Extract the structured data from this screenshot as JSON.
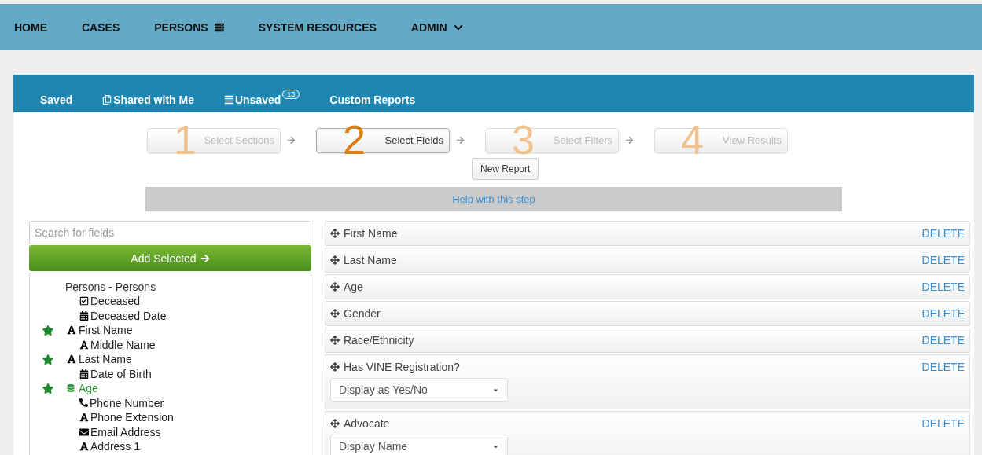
{
  "nav": [
    {
      "label": "HOME",
      "kind": "plain"
    },
    {
      "label": "CASES",
      "kind": "plain"
    },
    {
      "label": "PERSONS",
      "kind": "list"
    },
    {
      "label": "SYSTEM RESOURCES",
      "kind": "plain"
    },
    {
      "label": "ADMIN",
      "kind": "dropdown"
    }
  ],
  "report_tabs": [
    {
      "label": "Saved",
      "kind": "plain"
    },
    {
      "label": "Shared with Me",
      "kind": "shared"
    },
    {
      "label": "Unsaved",
      "kind": "unsaved",
      "badge": "13"
    },
    {
      "label": "Custom Reports",
      "kind": "plain"
    }
  ],
  "steps": [
    {
      "number": "1",
      "label": "Select Sections",
      "selected": false
    },
    {
      "number": "2",
      "label": "Select Fields",
      "selected": true
    },
    {
      "number": "3",
      "label": "Select Filters",
      "selected": false
    },
    {
      "number": "4",
      "label": "View Results",
      "selected": false
    }
  ],
  "new_report_button": "New Report",
  "help_link": "Help with this step",
  "search": {
    "placeholder": "Search for fields"
  },
  "add_button": "Add Selected",
  "tree": {
    "label": "Persons - Persons",
    "children": [
      {
        "label": "Deceased",
        "kind": "checkbox",
        "starred": false,
        "highlighted": false
      },
      {
        "label": "Deceased Date",
        "kind": "date",
        "starred": false,
        "highlighted": false
      },
      {
        "label": "First Name",
        "kind": "text",
        "starred": true,
        "highlighted": false
      },
      {
        "label": "Middle Name",
        "kind": "text",
        "starred": false,
        "highlighted": false
      },
      {
        "label": "Last Name",
        "kind": "text",
        "starred": true,
        "highlighted": false
      },
      {
        "label": "Date of Birth",
        "kind": "date",
        "starred": false,
        "highlighted": false
      },
      {
        "label": "Age",
        "kind": "sql",
        "starred": true,
        "highlighted": true
      },
      {
        "label": "Phone Number",
        "kind": "phone",
        "starred": false,
        "highlighted": false
      },
      {
        "label": "Phone Extension",
        "kind": "text",
        "starred": false,
        "highlighted": false
      },
      {
        "label": "Email Address",
        "kind": "email",
        "starred": false,
        "highlighted": false
      },
      {
        "label": "Address 1",
        "kind": "text",
        "starred": false,
        "highlighted": false
      }
    ]
  },
  "fields": [
    {
      "label": "First Name",
      "delete": "DELETE",
      "kind": "plain"
    },
    {
      "label": "Last Name",
      "delete": "DELETE",
      "kind": "plain"
    },
    {
      "label": "Age",
      "delete": "DELETE",
      "kind": "plain"
    },
    {
      "label": "Gender",
      "delete": "DELETE",
      "kind": "plain"
    },
    {
      "label": "Race/Ethnicity",
      "delete": "DELETE",
      "kind": "plain"
    },
    {
      "label": "Has VINE Registration?",
      "delete": "DELETE",
      "kind": "select",
      "value": "Display as Yes/No"
    },
    {
      "label": "Advocate",
      "delete": "DELETE",
      "kind": "select",
      "value": "Display Name"
    }
  ]
}
